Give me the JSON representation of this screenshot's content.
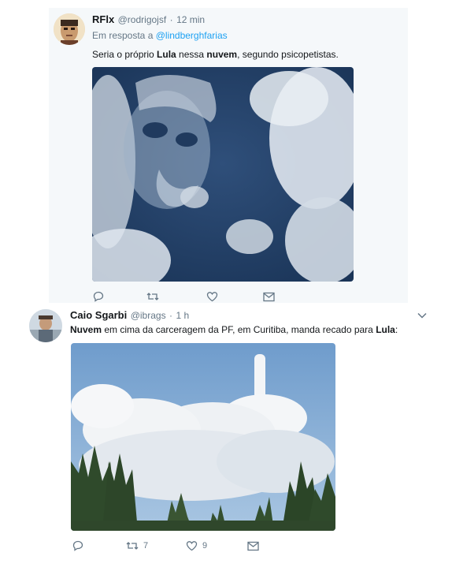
{
  "tweets": [
    {
      "name": "RFlx",
      "handle": "@rodrigojsf",
      "separator": "·",
      "time": "12 min",
      "reply_prefix": "Em resposta a",
      "reply_to": "@lindberghfarias",
      "text_parts": [
        "Seria o próprio ",
        "Lula",
        " nessa ",
        "nuvem",
        ", segundo psicopetistas."
      ],
      "image_alt": "cloud face image",
      "actions": {
        "reply_count": "",
        "retweet_count": "",
        "like_count": ""
      }
    },
    {
      "name": "Caio Sgarbi",
      "handle": "@ibrags",
      "separator": "·",
      "time": "1 h",
      "text_parts": [
        "Nuvem",
        " em cima da carceragem da PF, em Curitiba, manda recado para ",
        "Lula",
        ":"
      ],
      "image_alt": "cloud over trees image",
      "actions": {
        "reply_count": "",
        "retweet_count": "7",
        "like_count": "9"
      }
    }
  ],
  "icons": [
    "reply-icon",
    "retweet-icon",
    "like-icon",
    "direct-message-icon",
    "chevron-down-icon"
  ],
  "colors": {
    "accent": "#1da1f2",
    "muted": "#657786",
    "highlight_bg": "#f5f8fa"
  }
}
